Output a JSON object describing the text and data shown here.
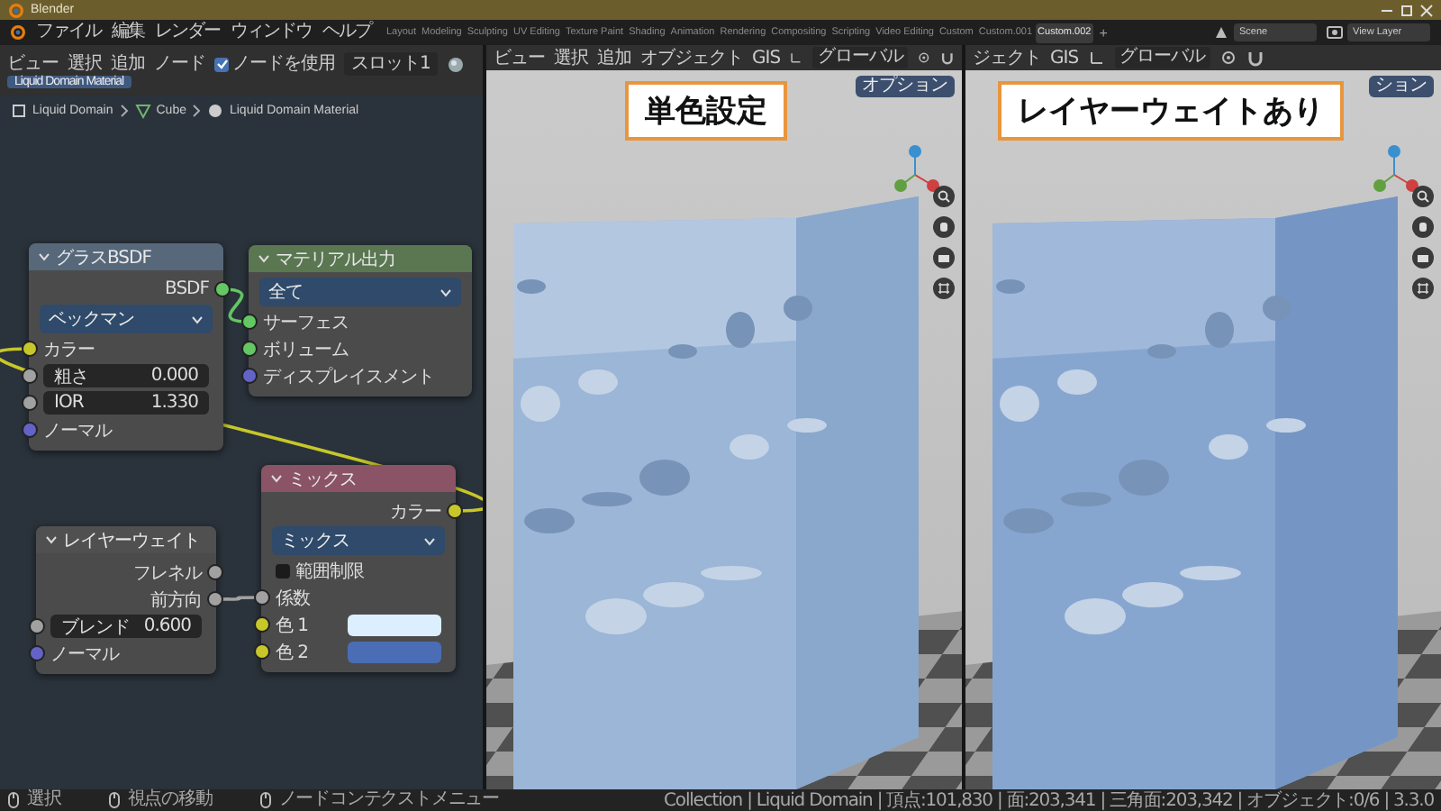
{
  "window": {
    "title": "Blender"
  },
  "menu": [
    "ファイル",
    "編集",
    "レンダー",
    "ウィンドウ",
    "ヘルプ"
  ],
  "workspaces": [
    {
      "label": "Layout",
      "selected": false
    },
    {
      "label": "Modeling",
      "selected": false
    },
    {
      "label": "Sculpting",
      "selected": false
    },
    {
      "label": "UV Editing",
      "selected": false
    },
    {
      "label": "Texture Paint",
      "selected": false
    },
    {
      "label": "Shading",
      "selected": false
    },
    {
      "label": "Animation",
      "selected": false
    },
    {
      "label": "Rendering",
      "selected": false
    },
    {
      "label": "Compositing",
      "selected": false
    },
    {
      "label": "Scripting",
      "selected": false
    },
    {
      "label": "Video Editing",
      "selected": false
    },
    {
      "label": "Custom",
      "selected": false
    },
    {
      "label": "Custom.001",
      "selected": false
    },
    {
      "label": "Custom.002",
      "selected": true
    }
  ],
  "add_workspace": "+",
  "scene": {
    "value": "Scene"
  },
  "view_layer": {
    "value": "View Layer"
  },
  "node_editor": {
    "menu": [
      "ビュー",
      "選択",
      "追加",
      "ノード"
    ],
    "use_nodes": {
      "label": "ノードを使用",
      "checked": true
    },
    "slot": "スロット1",
    "material": "Liquid Domain Material",
    "breadcrumbs": [
      "Liquid Domain",
      "Cube",
      "Liquid Domain Material"
    ],
    "nodes": [
      {
        "title": "グラスBSDF",
        "color": "#56687a",
        "rows": [
          {
            "kind": "output",
            "label": "BSDF",
            "socket": {
              "color": "#63c763"
            }
          },
          {
            "kind": "dropdown",
            "value": "ベックマン"
          },
          {
            "kind": "input",
            "label": "カラー",
            "socket": {
              "color": "#c7c729"
            }
          },
          {
            "kind": "field",
            "label": "粗さ",
            "value": "0.000",
            "socket": {
              "color": "#a1a1a1"
            }
          },
          {
            "kind": "field",
            "label": "IOR",
            "value": "1.330",
            "socket": {
              "color": "#a1a1a1"
            }
          },
          {
            "kind": "input",
            "label": "ノーマル",
            "socket": {
              "color": "#6363c7"
            }
          }
        ]
      },
      {
        "title": "レイヤーウェイト",
        "color": "#505050",
        "rows": [
          {
            "kind": "output",
            "label": "フレネル",
            "socket": {
              "color": "#a1a1a1"
            }
          },
          {
            "kind": "output",
            "label": "前方向",
            "socket": {
              "color": "#a1a1a1"
            }
          },
          {
            "kind": "field",
            "label": "ブレンド",
            "value": "0.600",
            "socket": {
              "color": "#a1a1a1"
            }
          },
          {
            "kind": "input",
            "label": "ノーマル",
            "socket": {
              "color": "#6363c7"
            }
          }
        ]
      },
      {
        "title": "マテリアル出力",
        "color": "#5a7752",
        "rows": [
          {
            "kind": "dropdown",
            "value": "全て"
          },
          {
            "kind": "input",
            "label": "サーフェス",
            "socket": {
              "color": "#63c763"
            }
          },
          {
            "kind": "input",
            "label": "ボリューム",
            "socket": {
              "color": "#63c763"
            }
          },
          {
            "kind": "input",
            "label": "ディスプレイスメント",
            "socket": {
              "color": "#6363c7"
            }
          }
        ]
      },
      {
        "title": "ミックス",
        "color": "#8a5366",
        "rows": [
          {
            "kind": "output",
            "label": "カラー",
            "socket": {
              "color": "#c7c729"
            }
          },
          {
            "kind": "dropdown",
            "value": "ミックス"
          },
          {
            "kind": "checkbox",
            "label": "範囲制限",
            "checked": false
          },
          {
            "kind": "input",
            "label": "係数",
            "socket": {
              "color": "#a1a1a1"
            }
          },
          {
            "kind": "color",
            "label": "色 1",
            "socket": {
              "color": "#c7c729"
            },
            "color": "#dcefff"
          },
          {
            "kind": "color",
            "label": "色 2",
            "socket": {
              "color": "#c7c729"
            },
            "color": "#4a6db5"
          }
        ]
      }
    ]
  },
  "viewports": [
    {
      "menu": [
        "ビュー",
        "選択",
        "追加",
        "オブジェクト",
        "GIS"
      ],
      "orientation": "グローバル",
      "options": "オプション",
      "label": "単色設定"
    },
    {
      "menu": [
        "ジェクト",
        "GIS"
      ],
      "orientation": "グローバル",
      "options": "ション",
      "label": "レイヤーウェイトあり"
    }
  ],
  "status_bar": {
    "hints": [
      "選択",
      "視点の移動",
      "ノードコンテクストメニュー"
    ],
    "stats": "Collection | Liquid Domain | 頂点:101,830 | 面:203,341 | 三角面:203,342 | オブジェクト:0/6 | 3.3.0"
  }
}
